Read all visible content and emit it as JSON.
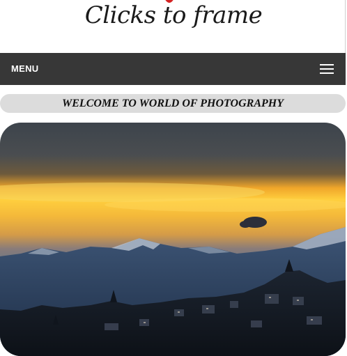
{
  "logo": {
    "text": "Clicks to frame",
    "heart_color": "#d42424"
  },
  "nav": {
    "menu_label": "MENU",
    "toggle_icon": "hamburger-icon"
  },
  "welcome": {
    "text": "WELCOME TO WORLD OF PHOTOGRAPHY"
  },
  "hero": {
    "subject": "sunset over mountains and town"
  },
  "colors": {
    "nav_bg": "#373737",
    "banner_bg": "#dcdcdc"
  }
}
